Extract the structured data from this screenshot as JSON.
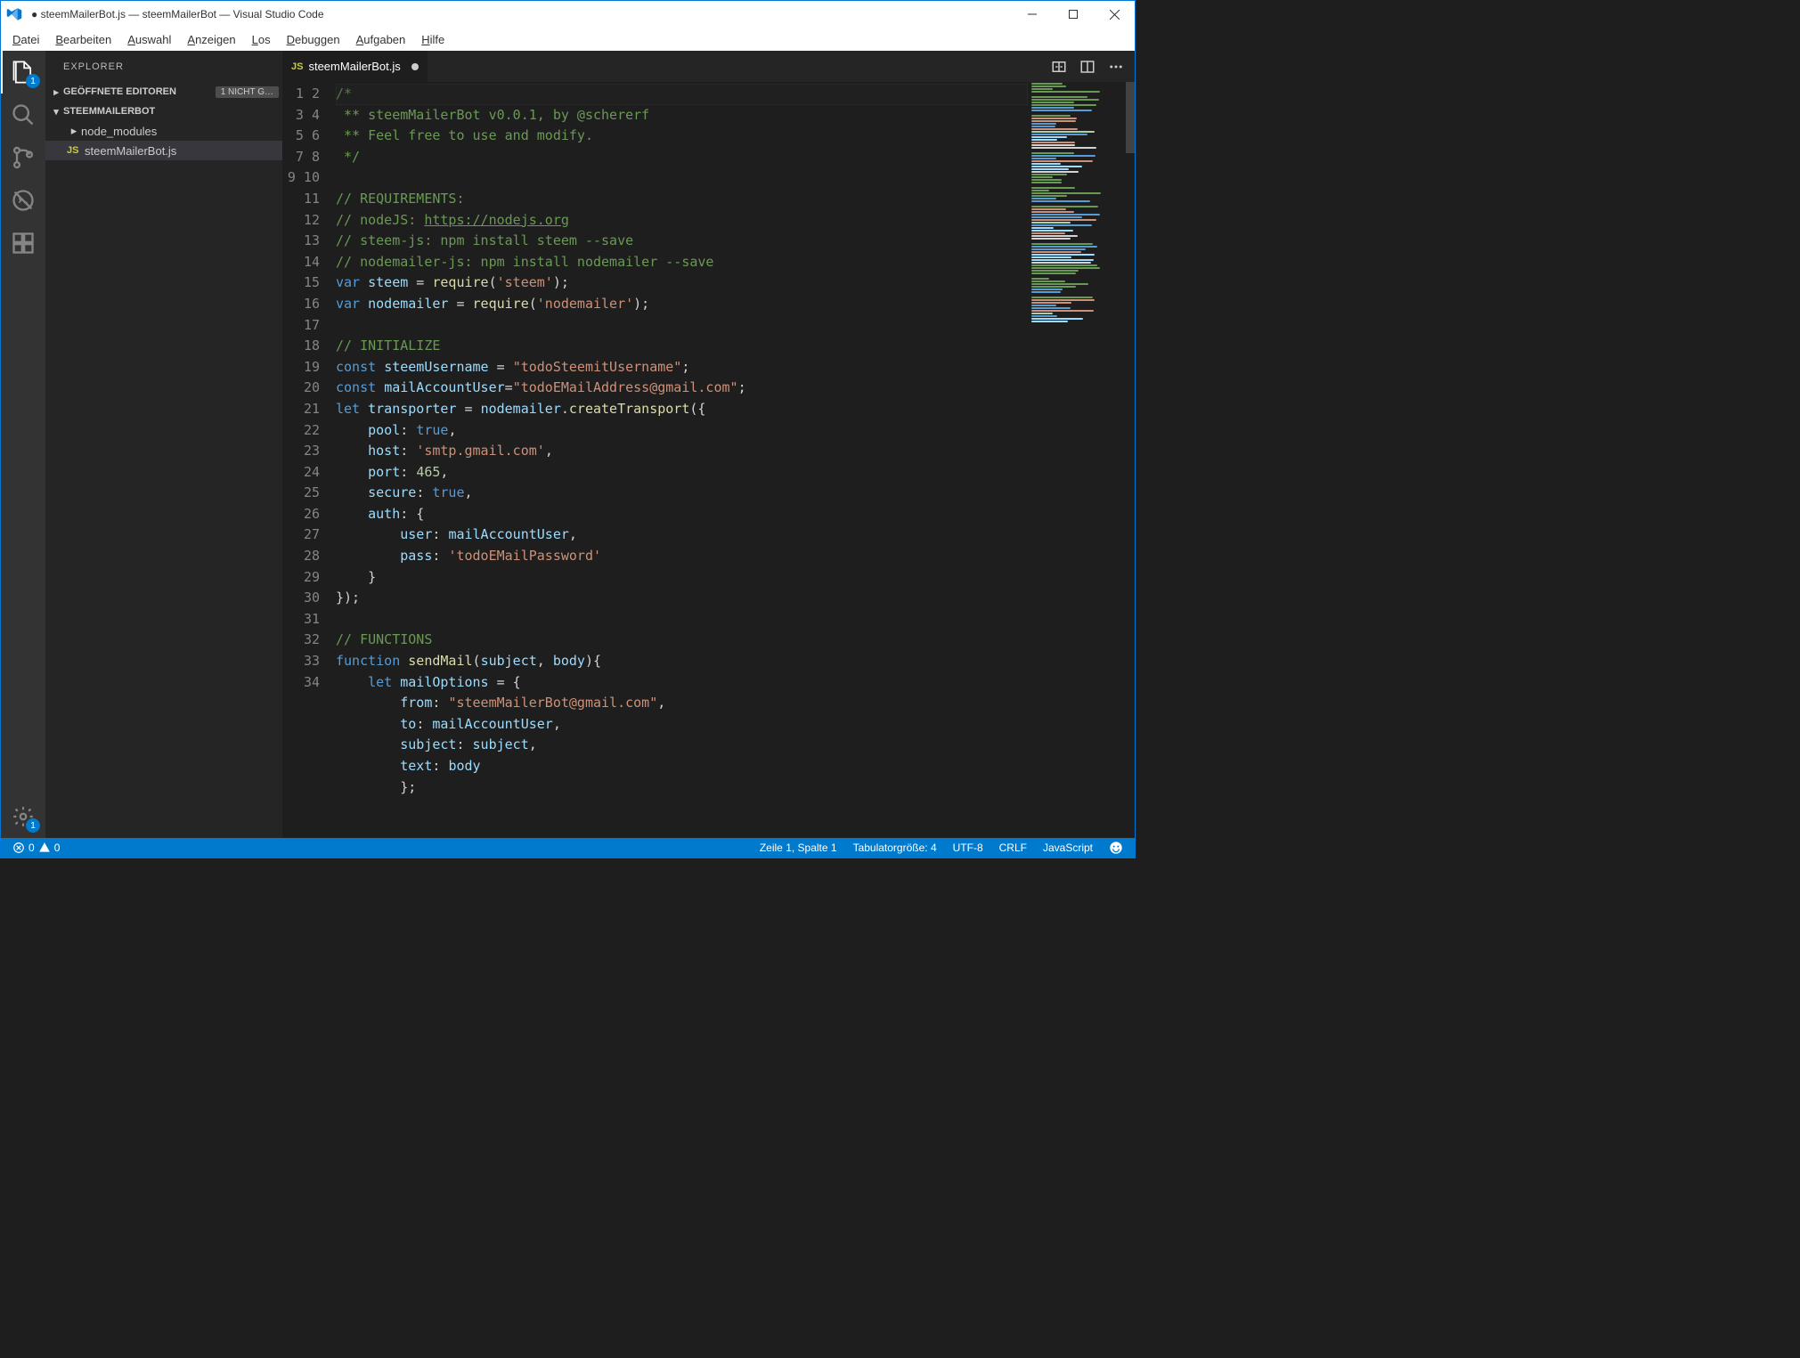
{
  "window": {
    "title": "● steemMailerBot.js — steemMailerBot — Visual Studio Code"
  },
  "menu": [
    "Datei",
    "Bearbeiten",
    "Auswahl",
    "Anzeigen",
    "Los",
    "Debuggen",
    "Aufgaben",
    "Hilfe"
  ],
  "activity_badge_explorer": "1",
  "activity_badge_settings": "1",
  "sidebar": {
    "title": "EXPLORER",
    "section_open": "GEÖFFNETE EDITOREN",
    "section_open_tag": "1 NICHT G…",
    "section_proj": "STEEMMAILERBOT",
    "items": [
      {
        "label": "node_modules",
        "type": "folder"
      },
      {
        "label": "steemMailerBot.js",
        "type": "js",
        "selected": true
      }
    ]
  },
  "tab": {
    "icon": "JS",
    "label": "steemMailerBot.js"
  },
  "code_lines": 34,
  "status": {
    "errors": "0",
    "warnings": "0",
    "line_col": "Zeile 1, Spalte 1",
    "tabsize": "Tabulatorgröße: 4",
    "encoding": "UTF-8",
    "eol": "CRLF",
    "lang": "JavaScript"
  },
  "code": {
    "l1": "/*",
    "l2": " ** steemMailerBot v0.0.1, by @schererf",
    "l3": " ** Feel free to use and modify.",
    "l4": " */",
    "l6": "// REQUIREMENTS:",
    "l7a": "// nodeJS: ",
    "l7b": "https://nodejs.org",
    "l8": "// steem-js: npm install steem --save",
    "l9": "// nodemailer-js: npm install nodemailer --save",
    "kw_var": "var",
    "kw_const": "const",
    "kw_let": "let",
    "kw_function": "function",
    "kw_true": "true",
    "v_steem": "steem",
    "v_nodemailer": "nodemailer",
    "v_steemUsername": "steemUsername",
    "v_mailAccountUser": "mailAccountUser",
    "v_transporter": "transporter",
    "v_pool": "pool",
    "v_host": "host",
    "v_port": "port",
    "v_secure": "secure",
    "v_auth": "auth",
    "v_user": "user",
    "v_pass": "pass",
    "v_mailOptions": "mailOptions",
    "v_from": "from",
    "v_to": "to",
    "v_subject": "subject",
    "v_text": "text",
    "v_body": "body",
    "f_require": "require",
    "f_createTransport": "createTransport",
    "f_sendMail": "sendMail",
    "s_steem": "'steem'",
    "s_nodemailer": "'nodemailer'",
    "s_user": "\"todoSteemitUsername\"",
    "s_mail": "\"todoEMailAddress@gmail.com\"",
    "s_smtp": "'smtp.gmail.com'",
    "s_pass": "'todoEMailPassword'",
    "s_from": "\"steemMailerBot@gmail.com\"",
    "n_465": "465",
    "l13": "// INITIALIZE",
    "l27": "// FUNCTIONS"
  }
}
